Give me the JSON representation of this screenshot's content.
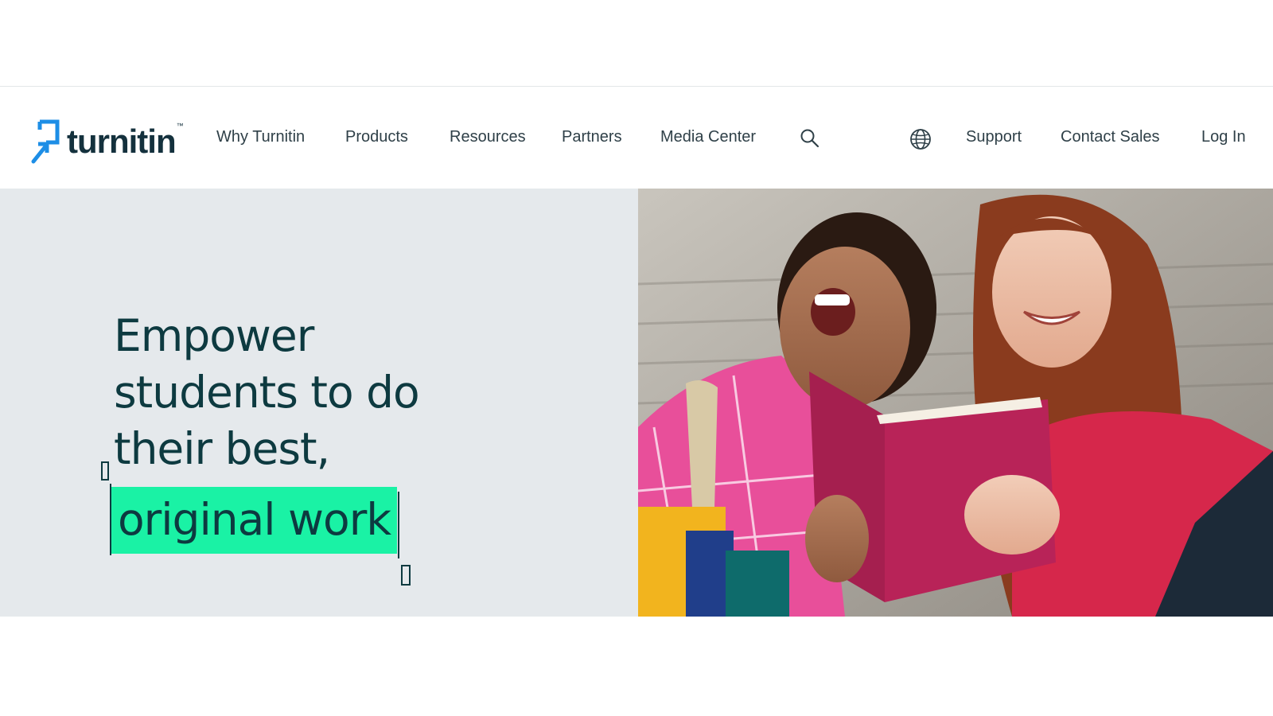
{
  "brand": {
    "name": "turnitin",
    "trademark": "™",
    "colors": {
      "primary": "#14313d",
      "accent_blue": "#1d8ee6",
      "highlight": "#1af2a5",
      "hero_bg": "#e5e9ec"
    }
  },
  "nav": {
    "items": [
      {
        "label": "Why Turnitin"
      },
      {
        "label": "Products"
      },
      {
        "label": "Resources"
      },
      {
        "label": "Partners"
      },
      {
        "label": "Media Center"
      }
    ],
    "search_icon": "search-icon",
    "globe_icon": "globe-icon",
    "right_items": [
      {
        "label": "Support"
      },
      {
        "label": "Contact Sales"
      },
      {
        "label": "Log In"
      }
    ]
  },
  "hero": {
    "headline_lines": [
      "Empower",
      "students to do",
      "their best,"
    ],
    "highlight": "original work",
    "image_description": "students-reading-book-photo"
  }
}
